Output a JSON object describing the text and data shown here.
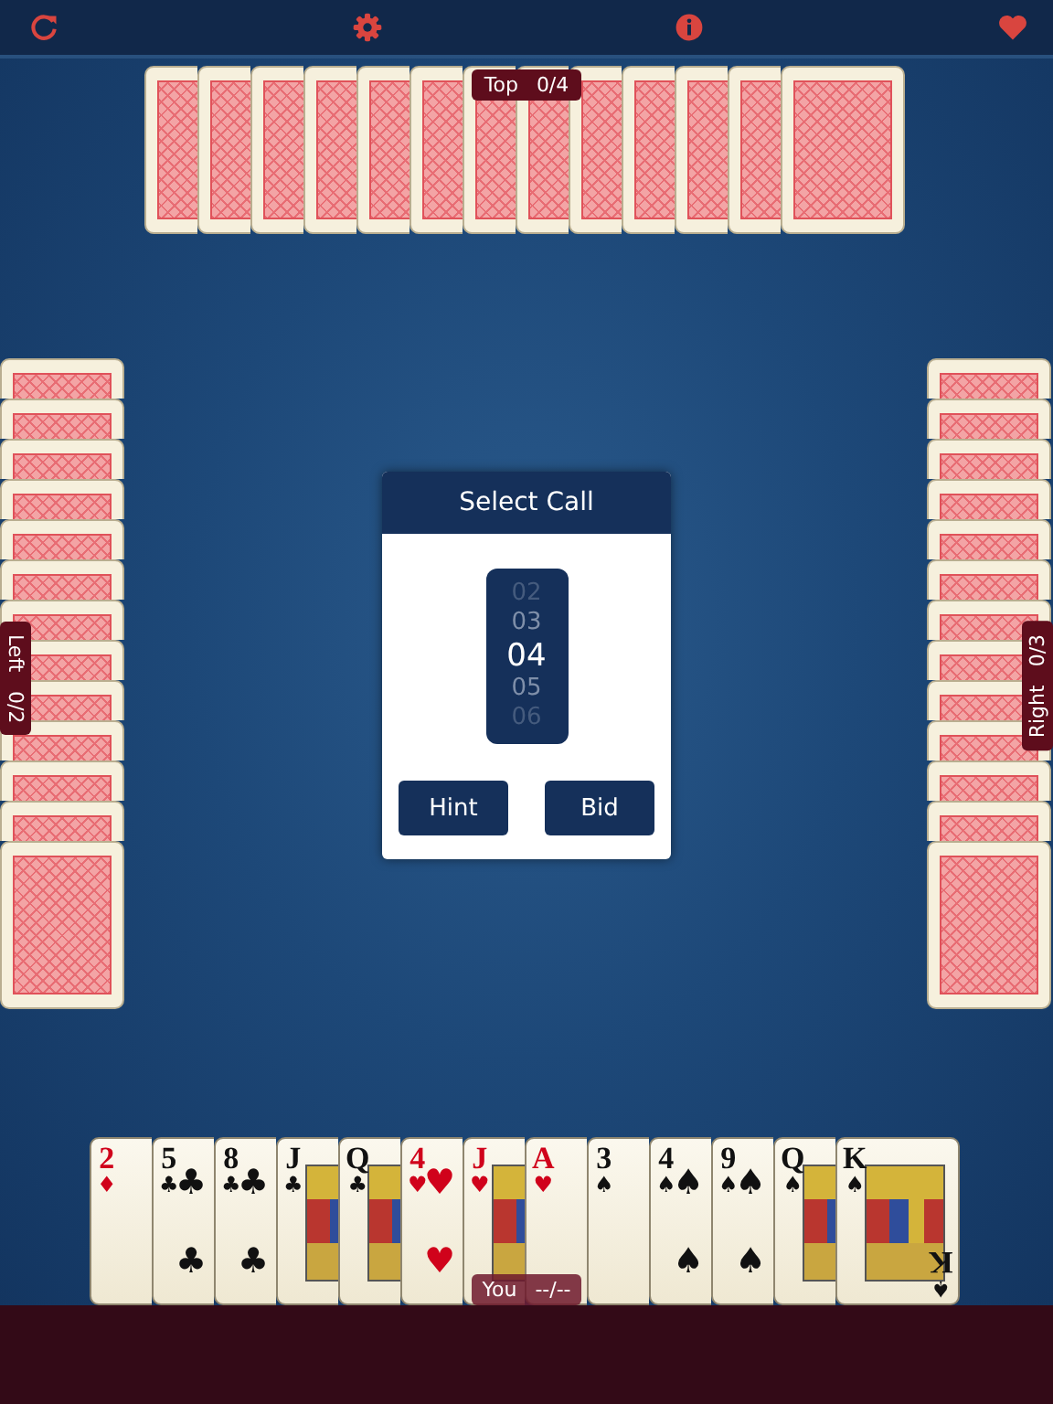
{
  "toolbar": {
    "buttons": [
      {
        "kind": "refresh"
      },
      {
        "kind": "settings"
      },
      {
        "kind": "info"
      },
      {
        "kind": "heart"
      }
    ]
  },
  "opponents": [
    {
      "kind": "top",
      "name": "Top",
      "score": "0/4",
      "cards": [
        {
          "face_down": true
        },
        {
          "face_down": true
        },
        {
          "face_down": true
        },
        {
          "face_down": true
        },
        {
          "face_down": true
        },
        {
          "face_down": true
        },
        {
          "face_down": true
        },
        {
          "face_down": true
        },
        {
          "face_down": true
        },
        {
          "face_down": true
        },
        {
          "face_down": true
        },
        {
          "face_down": true
        },
        {
          "face_down": true
        }
      ]
    },
    {
      "kind": "left",
      "name": "Left",
      "score": "0/2",
      "cards": [
        {
          "face_down": true
        },
        {
          "face_down": true
        },
        {
          "face_down": true
        },
        {
          "face_down": true
        },
        {
          "face_down": true
        },
        {
          "face_down": true
        },
        {
          "face_down": true
        },
        {
          "face_down": true
        },
        {
          "face_down": true
        },
        {
          "face_down": true
        },
        {
          "face_down": true
        },
        {
          "face_down": true
        },
        {
          "face_down": true
        }
      ]
    },
    {
      "kind": "right",
      "name": "Right",
      "score": "0/3",
      "cards": [
        {
          "face_down": true
        },
        {
          "face_down": true
        },
        {
          "face_down": true
        },
        {
          "face_down": true
        },
        {
          "face_down": true
        },
        {
          "face_down": true
        },
        {
          "face_down": true
        },
        {
          "face_down": true
        },
        {
          "face_down": true
        },
        {
          "face_down": true
        },
        {
          "face_down": true
        },
        {
          "face_down": true
        },
        {
          "face_down": true
        }
      ]
    }
  ],
  "dialog": {
    "title": "Select Call",
    "picker": {
      "values": [
        {
          "label": "02",
          "selected": false
        },
        {
          "label": "03",
          "selected": false
        },
        {
          "label": "04",
          "selected": true
        },
        {
          "label": "05",
          "selected": false
        },
        {
          "label": "06",
          "selected": false
        }
      ]
    },
    "buttons": [
      "Hint",
      "Bid"
    ]
  },
  "player": {
    "name": "You",
    "score": "--/--",
    "hand": [
      {
        "rank": "2",
        "suit": "♦",
        "kind": "number",
        "color": "#d0021b"
      },
      {
        "rank": "5",
        "suit": "♣",
        "kind": "number",
        "color": "#111111",
        "pips": [
          "♣",
          "♣"
        ]
      },
      {
        "rank": "8",
        "suit": "♣",
        "kind": "number",
        "color": "#111111",
        "pips": [
          "♣",
          "♣"
        ]
      },
      {
        "rank": "J",
        "suit": "♣",
        "kind": "face",
        "color": "#111111"
      },
      {
        "rank": "Q",
        "suit": "♣",
        "kind": "face",
        "color": "#111111"
      },
      {
        "rank": "4",
        "suit": "♥",
        "kind": "number",
        "color": "#d0021b",
        "pips": [
          "♥",
          "♥"
        ]
      },
      {
        "rank": "J",
        "suit": "♥",
        "kind": "face",
        "color": "#d0021b"
      },
      {
        "rank": "A",
        "suit": "♥",
        "kind": "number",
        "color": "#d0021b"
      },
      {
        "rank": "3",
        "suit": "♠",
        "kind": "number",
        "color": "#111111"
      },
      {
        "rank": "4",
        "suit": "♠",
        "kind": "number",
        "color": "#111111",
        "pips": [
          "♠",
          "♠"
        ]
      },
      {
        "rank": "9",
        "suit": "♠",
        "kind": "number",
        "color": "#111111",
        "pips": [
          "♠",
          "♠"
        ]
      },
      {
        "rank": "Q",
        "suit": "♠",
        "kind": "face",
        "color": "#111111"
      },
      {
        "rank": "K",
        "suit": "♠",
        "kind": "face",
        "color": "#111111",
        "rank_bottom": "K",
        "suit_bottom": "♠"
      }
    ]
  }
}
